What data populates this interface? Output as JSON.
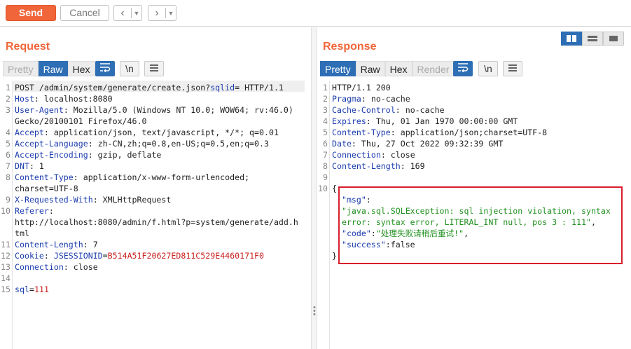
{
  "toolbar": {
    "send_label": "Send",
    "cancel_label": "Cancel",
    "back_icon": "chevron-left-icon",
    "forward_icon": "chevron-right-icon"
  },
  "request": {
    "title": "Request",
    "tabs": [
      "Pretty",
      "Raw",
      "Hex"
    ],
    "active_tab": "Raw",
    "lines": [
      {
        "n": "1",
        "parts": [
          [
            "POST /admin/system/generate/create.json?",
            ""
          ],
          [
            "sqlid",
            "k"
          ],
          [
            "= HTTP/1.1",
            ""
          ]
        ]
      },
      {
        "n": "2",
        "parts": [
          [
            "Host",
            "k"
          ],
          [
            ": localhost:8080",
            ""
          ]
        ]
      },
      {
        "n": "3",
        "parts": [
          [
            "User-Agent",
            "k"
          ],
          [
            ": Mozilla/5.0 (Windows NT 10.0; WOW64; rv:46.0)",
            ""
          ]
        ]
      },
      {
        "n": "",
        "parts": [
          [
            "Gecko/20100101 Firefox/46.0",
            ""
          ]
        ]
      },
      {
        "n": "4",
        "parts": [
          [
            "Accept",
            "k"
          ],
          [
            ": application/json, text/javascript, */*; q=0.01",
            ""
          ]
        ]
      },
      {
        "n": "5",
        "parts": [
          [
            "Accept-Language",
            "k"
          ],
          [
            ": zh-CN,zh;q=0.8,en-US;q=0.5,en;q=0.3",
            ""
          ]
        ]
      },
      {
        "n": "6",
        "parts": [
          [
            "Accept-Encoding",
            "k"
          ],
          [
            ": gzip, deflate",
            ""
          ]
        ]
      },
      {
        "n": "7",
        "parts": [
          [
            "DNT",
            "k"
          ],
          [
            ": 1",
            ""
          ]
        ]
      },
      {
        "n": "8",
        "parts": [
          [
            "Content-Type",
            "k"
          ],
          [
            ": application/x-www-form-urlencoded;",
            ""
          ]
        ]
      },
      {
        "n": "",
        "parts": [
          [
            "charset=UTF-8",
            ""
          ]
        ]
      },
      {
        "n": "9",
        "parts": [
          [
            "X-Requested-With",
            "k"
          ],
          [
            ": XMLHttpRequest",
            ""
          ]
        ]
      },
      {
        "n": "10",
        "parts": [
          [
            "Referer",
            "k"
          ],
          [
            ":",
            ""
          ]
        ]
      },
      {
        "n": "",
        "parts": [
          [
            "http://localhost:8080/admin/f.html?p=system/generate/add.h",
            ""
          ]
        ]
      },
      {
        "n": "",
        "parts": [
          [
            "tml",
            ""
          ]
        ]
      },
      {
        "n": "11",
        "parts": [
          [
            "Content-Length",
            "k"
          ],
          [
            ": 7",
            ""
          ]
        ]
      },
      {
        "n": "12",
        "parts": [
          [
            "Cookie",
            "k"
          ],
          [
            ": ",
            ""
          ],
          [
            "JSESSIONID",
            "k"
          ],
          [
            "=",
            ""
          ],
          [
            "B514A51F20627ED811C529E4460171F0",
            "red"
          ]
        ]
      },
      {
        "n": "13",
        "parts": [
          [
            "Connection",
            "k"
          ],
          [
            ": close",
            ""
          ]
        ]
      },
      {
        "n": "14",
        "parts": [
          [
            "",
            ""
          ]
        ]
      },
      {
        "n": "15",
        "parts": [
          [
            "sql",
            "k"
          ],
          [
            "=",
            ""
          ],
          [
            "111",
            "red"
          ]
        ]
      }
    ]
  },
  "response": {
    "title": "Response",
    "tabs": [
      "Pretty",
      "Raw",
      "Hex",
      "Render"
    ],
    "active_tab": "Pretty",
    "lines": [
      {
        "n": "1",
        "parts": [
          [
            "HTTP/1.1 200",
            ""
          ]
        ]
      },
      {
        "n": "2",
        "parts": [
          [
            "Pragma",
            "k"
          ],
          [
            ": no-cache",
            ""
          ]
        ]
      },
      {
        "n": "3",
        "parts": [
          [
            "Cache-Control",
            "k"
          ],
          [
            ": no-cache",
            ""
          ]
        ]
      },
      {
        "n": "4",
        "parts": [
          [
            "Expires",
            "k"
          ],
          [
            ": Thu, 01 Jan 1970 00:00:00 GMT",
            ""
          ]
        ]
      },
      {
        "n": "5",
        "parts": [
          [
            "Content-Type",
            "k"
          ],
          [
            ": application/json;charset=UTF-8",
            ""
          ]
        ]
      },
      {
        "n": "6",
        "parts": [
          [
            "Date",
            "k"
          ],
          [
            ": Thu, 27 Oct 2022 09:32:39 GMT",
            ""
          ]
        ]
      },
      {
        "n": "7",
        "parts": [
          [
            "Connection",
            "k"
          ],
          [
            ": close",
            ""
          ]
        ]
      },
      {
        "n": "8",
        "parts": [
          [
            "Content-Length",
            "k"
          ],
          [
            ": 169",
            ""
          ]
        ]
      },
      {
        "n": "9",
        "parts": [
          [
            "",
            ""
          ]
        ]
      },
      {
        "n": "10",
        "parts": [
          [
            "{",
            ""
          ]
        ]
      },
      {
        "n": "",
        "parts": [
          [
            "  \"msg\"",
            "k"
          ],
          [
            ":",
            ""
          ]
        ]
      },
      {
        "n": "",
        "parts": [
          [
            "  \"java.sql.SQLException: sql injection violation, syntax",
            "s"
          ]
        ]
      },
      {
        "n": "",
        "parts": [
          [
            "  error: syntax error, LITERAL_INT null, pos 3 : 111\"",
            "s"
          ],
          [
            ",",
            ""
          ]
        ]
      },
      {
        "n": "",
        "parts": [
          [
            "  \"code\"",
            "k"
          ],
          [
            ":",
            ""
          ],
          [
            "\"处理失败请稍后重试!\"",
            "s"
          ],
          [
            ",",
            ""
          ]
        ]
      },
      {
        "n": "",
        "parts": [
          [
            "  \"success\"",
            "k"
          ],
          [
            ":false",
            ""
          ]
        ]
      },
      {
        "n": "",
        "parts": [
          [
            "}",
            ""
          ]
        ]
      }
    ]
  },
  "colors": {
    "accent": "#f0663a",
    "tab_active": "#2e6eb5",
    "highlight_box": "#d81d2c"
  }
}
